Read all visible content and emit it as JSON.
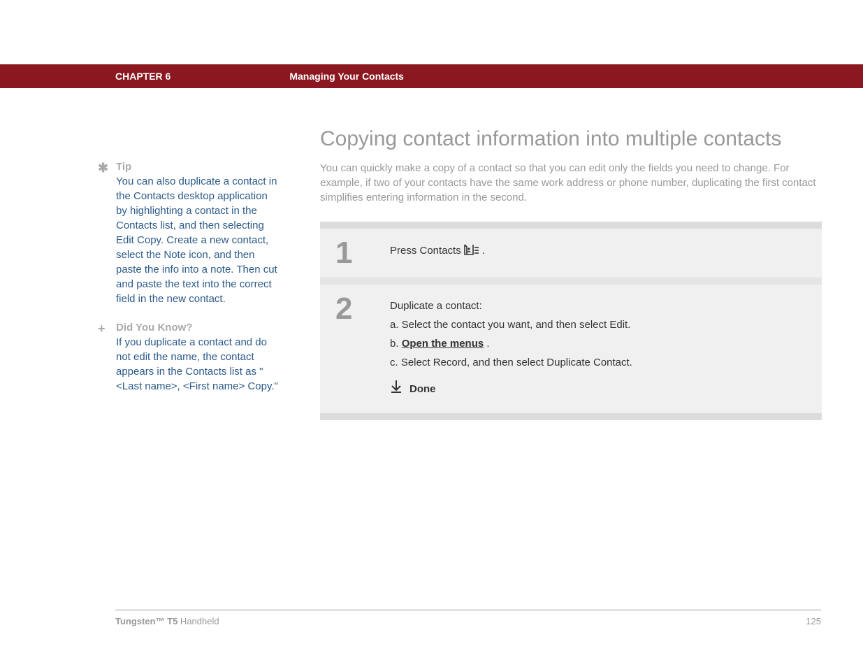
{
  "header": {
    "chapter_label": "CHAPTER 6",
    "chapter_title": "Managing Your Contacts"
  },
  "sidebar": {
    "tip": {
      "title": "Tip",
      "body": "You can also duplicate a contact in the Contacts desktop application by highlighting a contact in the Contacts list, and then selecting Edit Copy. Create a new contact, select the Note icon, and then paste the info into a note. Then cut and paste the text into the correct field in the new contact."
    },
    "dyk": {
      "title": "Did You Know?",
      "body": "If you duplicate a contact and do not edit the name, the contact appears in the Contacts list as \"<Last name>, <First name> Copy.\""
    }
  },
  "main": {
    "heading": "Copying contact information into multiple contacts",
    "intro": "You can quickly make a copy of a contact so that you can edit only the fields you need to change. For example, if two of your contacts have the same work address or phone number, duplicating the first contact simplifies entering information in the second.",
    "steps": [
      {
        "num": "1",
        "lead_prefix": "Press Contacts ",
        "lead_suffix": "."
      },
      {
        "num": "2",
        "lead": "Duplicate a contact:",
        "sub_a": "a.  Select the contact you want, and then select Edit.",
        "sub_b_prefix": "b.  ",
        "sub_b_link": "Open the menus",
        "sub_b_suffix": ".",
        "sub_c": "c.  Select Record, and then select Duplicate Contact.",
        "done": "Done"
      }
    ]
  },
  "footer": {
    "product_bold": "Tungsten™ T5",
    "product_rest": " Handheld",
    "page": "125"
  }
}
